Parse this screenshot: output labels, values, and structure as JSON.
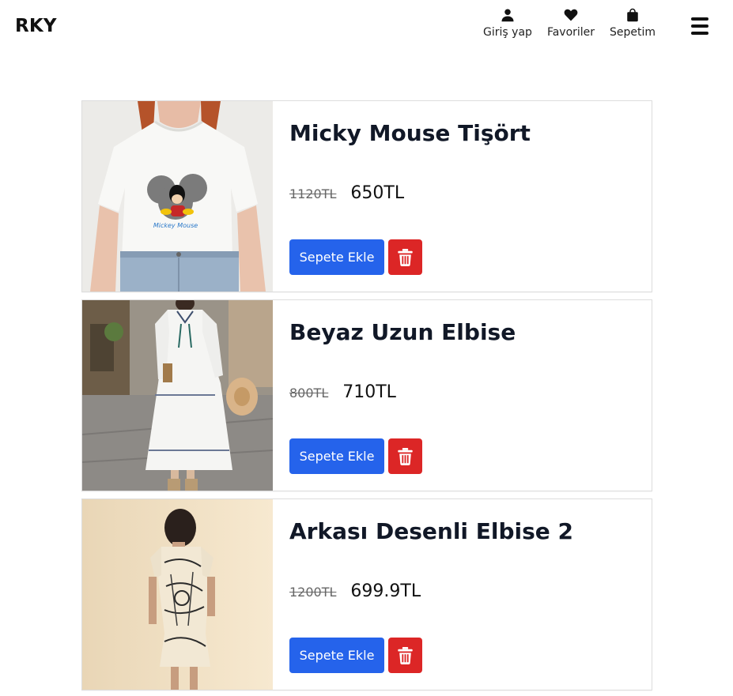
{
  "app": {
    "brand": "RKY"
  },
  "nav": {
    "login": {
      "label": "Giriş yap",
      "icon": "user-icon"
    },
    "favorites": {
      "label": "Favoriler",
      "icon": "heart-icon"
    },
    "cart": {
      "label": "Sepetim",
      "icon": "shopping-bag-icon"
    },
    "menu_icon": "hamburger-icon"
  },
  "products": [
    {
      "title": "Micky Mouse Tişört",
      "old_price": "1120TL",
      "price": "650TL",
      "add_label": "Sepete Ekle",
      "delete_icon": "trash-icon",
      "image": "product-image-tshirt"
    },
    {
      "title": "Beyaz Uzun Elbise",
      "old_price": "800TL",
      "price": "710TL",
      "add_label": "Sepete Ekle",
      "delete_icon": "trash-icon",
      "image": "product-image-white-dress"
    },
    {
      "title": "Arkası Desenli Elbise 2",
      "old_price": "1200TL",
      "price": "699.9TL",
      "add_label": "Sepete Ekle",
      "delete_icon": "trash-icon",
      "image": "product-image-patterned-dress"
    }
  ],
  "colors": {
    "primary": "#2563eb",
    "danger": "#dc2626",
    "text": "#111827"
  }
}
